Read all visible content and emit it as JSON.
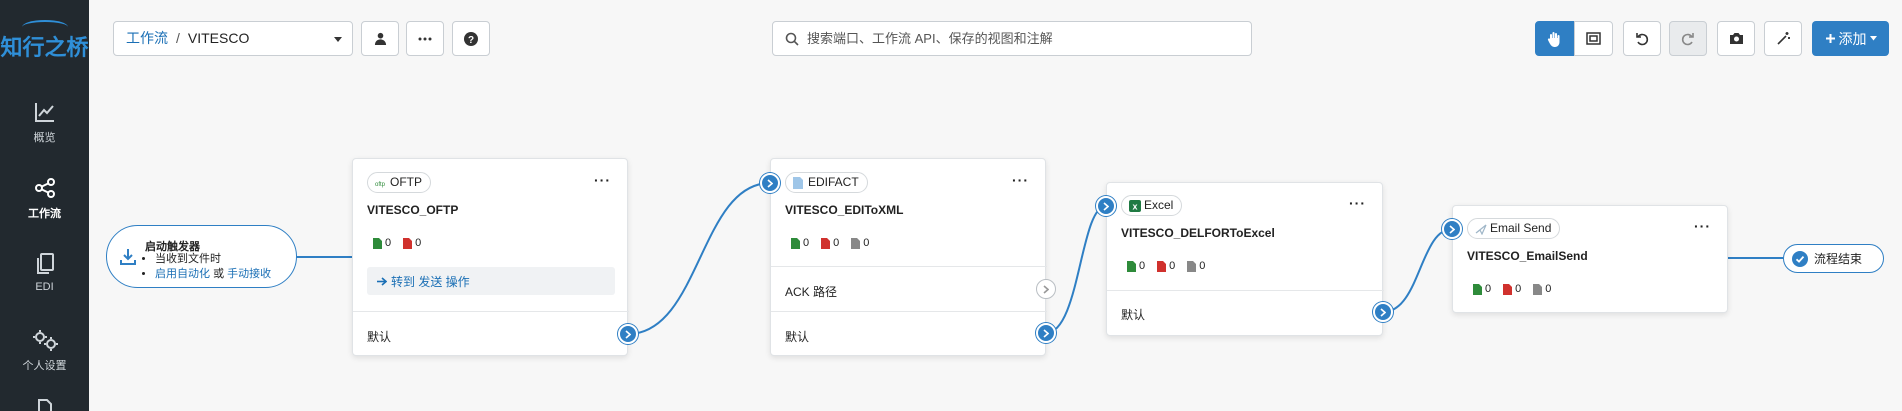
{
  "app": {
    "logo_text": "知行之桥"
  },
  "sidebar": {
    "items": [
      {
        "label": "概览",
        "icon": "chart-line-icon"
      },
      {
        "label": "工作流",
        "icon": "flow-share-icon"
      },
      {
        "label": "EDI",
        "icon": "documents-icon"
      },
      {
        "label": "个人设置",
        "icon": "gears-icon"
      }
    ]
  },
  "header": {
    "breadcrumb_root": "工作流",
    "breadcrumb_separator": "/",
    "breadcrumb_current": "VITESCO",
    "search_placeholder": "搜索端口、工作流 API、保存的视图和注解",
    "add_label": "添加"
  },
  "colors": {
    "accent": "#2f7fc4",
    "sidebar_bg": "#22292f",
    "success": "#2e8b3a",
    "error": "#d0312d",
    "neutral": "#888888"
  },
  "flow": {
    "start": {
      "title": "启动触发器",
      "line1": "当收到文件时",
      "link1": "启用自动化",
      "or": "或",
      "link2": "手动接收"
    },
    "nodes": [
      {
        "type": "OFTP",
        "name": "VITESCO_OFTP",
        "counts": {
          "success": "0",
          "error": "0"
        },
        "action": "转到 发送 操作",
        "outputs": [
          "默认"
        ]
      },
      {
        "type": "EDIFACT",
        "name": "VITESCO_EDIToXML",
        "counts": {
          "success": "0",
          "error": "0",
          "pending": "0"
        },
        "outputs": [
          "ACK 路径",
          "默认"
        ]
      },
      {
        "type": "Excel",
        "name": "VITESCO_DELFORToExcel",
        "counts": {
          "success": "0",
          "error": "0",
          "pending": "0"
        },
        "outputs": [
          "默认"
        ]
      },
      {
        "type": "Email Send",
        "name": "VITESCO_EmailSend",
        "counts": {
          "success": "0",
          "error": "0",
          "pending": "0"
        }
      }
    ],
    "end": {
      "label": "流程结束"
    }
  }
}
